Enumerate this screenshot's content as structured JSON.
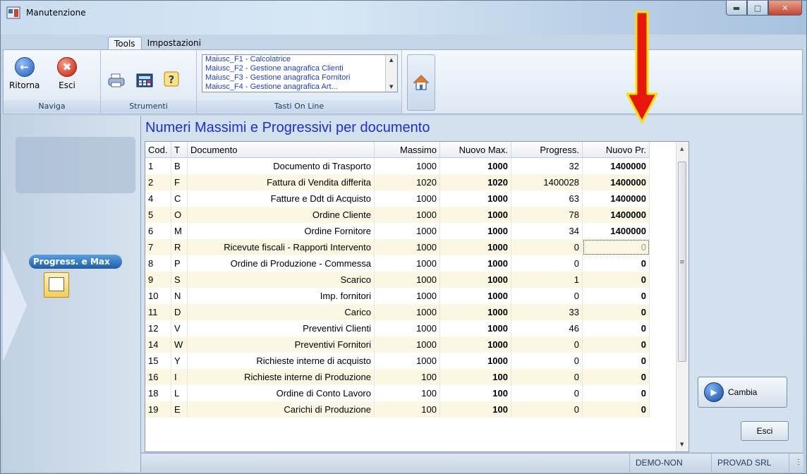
{
  "window": {
    "title": "Manutenzione"
  },
  "ribbon": {
    "tabs": [
      "Tools",
      "Impostazioni"
    ],
    "groups": {
      "naviga": {
        "label": "Naviga",
        "back_label": "Ritorna",
        "exit_label": "Esci"
      },
      "strumenti": {
        "label": "Strumenti"
      },
      "tasti_online": {
        "label": "Tasti On Line",
        "items": [
          "Maiusc_F1  - Calcolatrice",
          "Maiusc_F2  - Gestione anagrafica Clienti",
          "Maiusc_F3  - Gestione anagrafica Fornitori",
          "Maiusc_F4  - Gestione anagrafica Art..."
        ]
      }
    }
  },
  "sidebar": {
    "active_item": "Progress. e Max"
  },
  "main": {
    "heading": "Numeri Massimi e Progressivi per documento",
    "columns": [
      "Cod.",
      "T",
      "Documento",
      "Massimo",
      "Nuovo Max.",
      "Progress.",
      "Nuovo Pr."
    ],
    "rows": [
      [
        "1",
        "B",
        "Documento di Trasporto",
        "1000",
        "1000",
        "32",
        "1400000"
      ],
      [
        "2",
        "F",
        "Fattura di Vendita differita",
        "1020",
        "1020",
        "1400028",
        "1400000"
      ],
      [
        "4",
        "C",
        "Fatture e Ddt di Acquisto",
        "1000",
        "1000",
        "63",
        "1400000"
      ],
      [
        "5",
        "O",
        "Ordine Cliente",
        "1000",
        "1000",
        "78",
        "1400000"
      ],
      [
        "6",
        "M",
        "Ordine Fornitore",
        "1000",
        "1000",
        "34",
        "1400000"
      ],
      [
        "7",
        "R",
        "Ricevute fiscali - Rapporti Intervento",
        "1000",
        "1000",
        "0",
        "0"
      ],
      [
        "8",
        "P",
        "Ordine di Produzione - Commessa",
        "1000",
        "1000",
        "0",
        "0"
      ],
      [
        "9",
        "S",
        "Scarico",
        "1000",
        "1000",
        "1",
        "0"
      ],
      [
        "10",
        "N",
        "Imp. fornitori",
        "1000",
        "1000",
        "0",
        "0"
      ],
      [
        "11",
        "D",
        "Carico",
        "1000",
        "1000",
        "33",
        "0"
      ],
      [
        "12",
        "V",
        "Preventivi Clienti",
        "1000",
        "1000",
        "46",
        "0"
      ],
      [
        "14",
        "W",
        "Preventivi Fornitori",
        "1000",
        "1000",
        "0",
        "0"
      ],
      [
        "15",
        "Y",
        "Richieste interne di acquisto",
        "1000",
        "1000",
        "0",
        "0"
      ],
      [
        "16",
        "I",
        "Richieste interne di Produzione",
        "100",
        "100",
        "0",
        "0"
      ],
      [
        "18",
        "L",
        "Ordine di Conto Lavoro",
        "100",
        "100",
        "0",
        "0"
      ],
      [
        "19",
        "E",
        "Carichi di Produzione",
        "100",
        "100",
        "0",
        "0"
      ]
    ],
    "buttons": {
      "cambia": "Cambia",
      "esci": "Esci"
    }
  },
  "statusbar": {
    "user": "DEMO-NON",
    "company": "PROVAD SRL"
  },
  "colors": {
    "heading": "#1a2fd8",
    "arrow_fill": "#e8170d",
    "arrow_border": "#f5e400",
    "row_alt": "#fbf7e3"
  }
}
